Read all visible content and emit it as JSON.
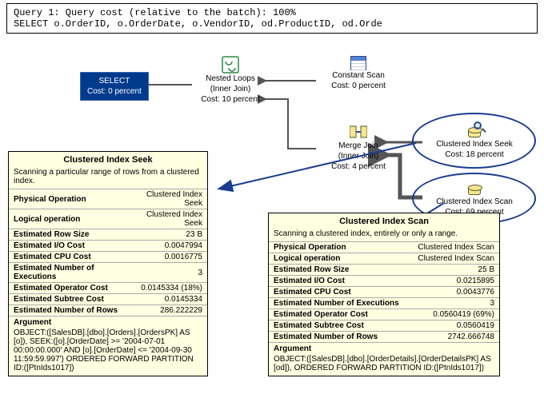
{
  "query": {
    "line1": "Query 1: Query cost (relative to the batch): 100%",
    "line2": "SELECT o.OrderID, o.OrderDate, o.VendorID, od.ProductID, od.Orde"
  },
  "nodes": {
    "select": {
      "label": "SELECT",
      "cost": "Cost: 0 percent"
    },
    "nestedLoops": {
      "label1": "Nested Loops",
      "label2": "(Inner Join)",
      "cost": "Cost: 10 percent"
    },
    "constantScan": {
      "label1": "Constant Scan",
      "cost": "Cost: 0 percent"
    },
    "mergeJoin": {
      "label1": "Merge Join",
      "label2": "(Inner Join)",
      "cost": "Cost: 4 percent"
    },
    "cixSeek": {
      "label1": "Clustered Index Seek",
      "cost": "Cost: 18 percent"
    },
    "cixScan": {
      "label1": "Clustered Index Scan",
      "cost": "Cost: 69 percent"
    }
  },
  "tooltipSeek": {
    "title": "Clustered Index Seek",
    "desc": "Scanning a particular range of rows from a clustered index.",
    "rows": [
      [
        "Physical Operation",
        "Clustered Index Seek"
      ],
      [
        "Logical operation",
        "Clustered Index Seek"
      ],
      [
        "Estimated Row Size",
        "23 B"
      ],
      [
        "Estimated I/O Cost",
        "0.0047994"
      ],
      [
        "Estimated CPU Cost",
        "0.0016775"
      ],
      [
        "Estimated Number of Executions",
        "3"
      ],
      [
        "Estimated Operator Cost",
        "0.0145334 (18%)"
      ],
      [
        "Estimated Subtree Cost",
        "0.0145334"
      ],
      [
        "Estimated Number of Rows",
        "286.222229"
      ]
    ],
    "argLabel": "Argument",
    "argument": "OBJECT:([SalesDB].[dbo].[Orders].[OrdersPK] AS [o]), SEEK:([o].[OrderDate] >= '2004-07-01 00:00:00.000' AND [o].[OrderDate] <= '2004-09-30 11:59:59.997') ORDERED FORWARD PARTITION ID:([PtnIds1017])"
  },
  "tooltipScan": {
    "title": "Clustered Index Scan",
    "desc": "Scanning a clustered index, entirely or only a range.",
    "rows": [
      [
        "Physical Operation",
        "Clustered Index Scan"
      ],
      [
        "Logical operation",
        "Clustered Index Scan"
      ],
      [
        "Estimated Row Size",
        "25 B"
      ],
      [
        "Estimated I/O Cost",
        "0.0215895"
      ],
      [
        "Estimated CPU Cost",
        "0.0043776"
      ],
      [
        "Estimated Number of Executions",
        "3"
      ],
      [
        "Estimated Operator Cost",
        "0.0560419 (69%)"
      ],
      [
        "Estimated Subtree Cost",
        "0.0560419"
      ],
      [
        "Estimated Number of Rows",
        "2742.666748"
      ]
    ],
    "argLabel": "Argument",
    "argument": "OBJECT:([SalesDB].[dbo].[OrderDetails].[OrderDetailsPK] AS [od]), ORDERED FORWARD PARTITION ID:([PtnIds1017])"
  }
}
